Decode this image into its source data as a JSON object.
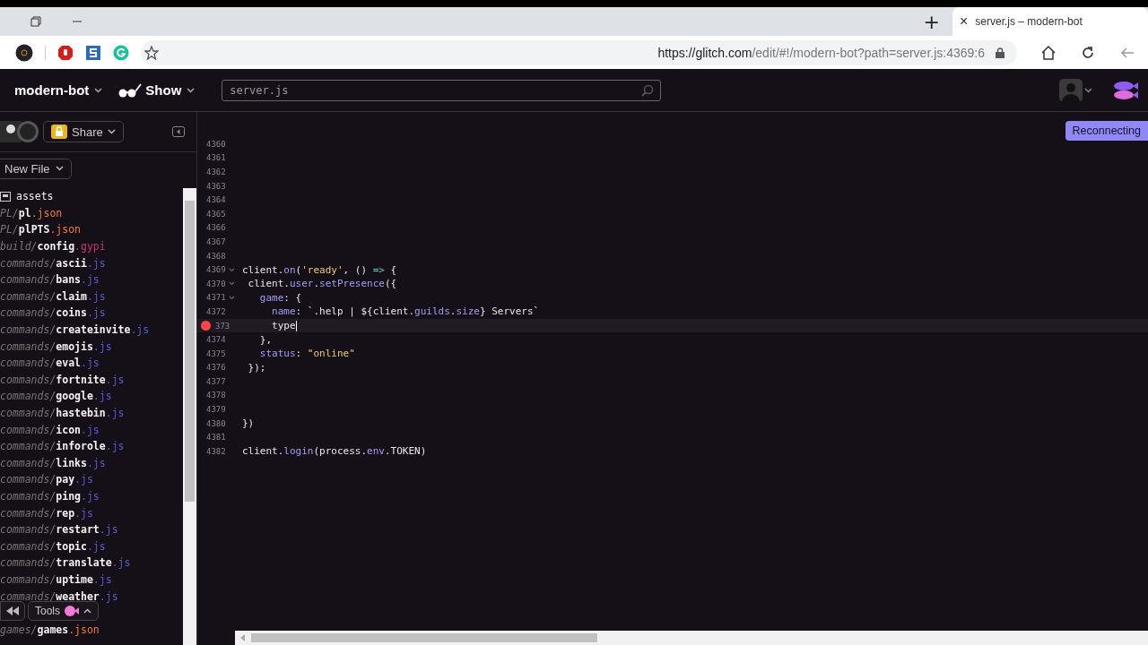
{
  "browser": {
    "tab_title": "server.js – modern-bot",
    "tab_close": "×",
    "new_tab": "+",
    "url_host": "https://glitch.com",
    "url_path": "/edit/#!/modern-bot?path=server.js:4369:6"
  },
  "header": {
    "project": "modern-bot",
    "show": "Show",
    "search": {
      "value": "server.js"
    }
  },
  "sidebar": {
    "share": "Share",
    "new_file": "New File",
    "assets": "assets",
    "files": [
      {
        "dir": "PL/",
        "name": "pl",
        "ext": ".json",
        "kind": "json"
      },
      {
        "dir": "PL/",
        "name": "plPTS",
        "ext": ".json",
        "kind": "json"
      },
      {
        "dir": "build/",
        "name": "config",
        "ext": ".gypi",
        "kind": "gypi"
      },
      {
        "dir": "commands/",
        "name": "ascii",
        "ext": ".js",
        "kind": "js"
      },
      {
        "dir": "commands/",
        "name": "bans",
        "ext": ".js",
        "kind": "js"
      },
      {
        "dir": "commands/",
        "name": "claim",
        "ext": ".js",
        "kind": "js"
      },
      {
        "dir": "commands/",
        "name": "coins",
        "ext": ".js",
        "kind": "js"
      },
      {
        "dir": "commands/",
        "name": "createinvite",
        "ext": ".js",
        "kind": "js"
      },
      {
        "dir": "commands/",
        "name": "emojis",
        "ext": ".js",
        "kind": "js"
      },
      {
        "dir": "commands/",
        "name": "eval",
        "ext": ".js",
        "kind": "js"
      },
      {
        "dir": "commands/",
        "name": "fortnite",
        "ext": ".js",
        "kind": "js"
      },
      {
        "dir": "commands/",
        "name": "google",
        "ext": ".js",
        "kind": "js"
      },
      {
        "dir": "commands/",
        "name": "hastebin",
        "ext": ".js",
        "kind": "js"
      },
      {
        "dir": "commands/",
        "name": "icon",
        "ext": ".js",
        "kind": "js"
      },
      {
        "dir": "commands/",
        "name": "inforole",
        "ext": ".js",
        "kind": "js"
      },
      {
        "dir": "commands/",
        "name": "links",
        "ext": ".js",
        "kind": "js"
      },
      {
        "dir": "commands/",
        "name": "pay",
        "ext": ".js",
        "kind": "js"
      },
      {
        "dir": "commands/",
        "name": "ping",
        "ext": ".js",
        "kind": "js"
      },
      {
        "dir": "commands/",
        "name": "rep",
        "ext": ".js",
        "kind": "js"
      },
      {
        "dir": "commands/",
        "name": "restart",
        "ext": ".js",
        "kind": "js"
      },
      {
        "dir": "commands/",
        "name": "topic",
        "ext": ".js",
        "kind": "js"
      },
      {
        "dir": "commands/",
        "name": "translate",
        "ext": ".js",
        "kind": "js"
      },
      {
        "dir": "commands/",
        "name": "uptime",
        "ext": ".js",
        "kind": "js"
      },
      {
        "dir": "commands/",
        "name": "weather",
        "ext": ".js",
        "kind": "js"
      }
    ],
    "tools": "Tools",
    "below_tools": {
      "dir": "games/",
      "name": "games",
      "ext": ".json",
      "kind": "json"
    }
  },
  "status_badge": "Reconnecting",
  "editor": {
    "lines": [
      {
        "number": "4360"
      },
      {
        "number": "4361"
      },
      {
        "number": "4362"
      },
      {
        "number": "4363"
      },
      {
        "number": "4364"
      },
      {
        "number": "4365"
      },
      {
        "number": "4366"
      },
      {
        "number": "4367"
      },
      {
        "number": "4368"
      },
      {
        "number": "4369",
        "fold": true,
        "tokens": [
          {
            "t": "client.",
            "kind": "plain"
          },
          {
            "t": "on",
            "kind": "prop"
          },
          {
            "t": "(",
            "kind": "plain"
          },
          {
            "t": "'ready'",
            "kind": "string"
          },
          {
            "t": ", () ",
            "kind": "plain"
          },
          {
            "t": "=>",
            "kind": "arrow"
          },
          {
            "t": " {",
            "kind": "plain"
          }
        ]
      },
      {
        "number": "4370",
        "fold": true,
        "tokens": [
          {
            "t": " client.",
            "kind": "plain"
          },
          {
            "t": "user",
            "kind": "prop"
          },
          {
            "t": ".",
            "kind": "plain"
          },
          {
            "t": "setPresence",
            "kind": "prop"
          },
          {
            "t": "({",
            "kind": "plain"
          }
        ]
      },
      {
        "number": "4371",
        "fold": true,
        "tokens": [
          {
            "t": "   game",
            "kind": "prop"
          },
          {
            "t": ": {",
            "kind": "plain"
          }
        ]
      },
      {
        "number": "4372",
        "tokens": [
          {
            "t": "     name",
            "kind": "prop"
          },
          {
            "t": ": `.help | ${client.",
            "kind": "plain"
          },
          {
            "t": "guilds",
            "kind": "prop"
          },
          {
            "t": ".",
            "kind": "plain"
          },
          {
            "t": "size",
            "kind": "prop"
          },
          {
            "t": "} Servers`",
            "kind": "plain"
          }
        ]
      },
      {
        "number": "373",
        "error": true,
        "current": true,
        "tokens": [
          {
            "t": "     type",
            "kind": "plain"
          }
        ]
      },
      {
        "number": "4374",
        "tokens": [
          {
            "t": "   },",
            "kind": "plain"
          }
        ]
      },
      {
        "number": "4375",
        "tokens": [
          {
            "t": "   status",
            "kind": "prop"
          },
          {
            "t": ": ",
            "kind": "plain"
          },
          {
            "t": "\"online\"",
            "kind": "string"
          }
        ]
      },
      {
        "number": "4376",
        "tokens": [
          {
            "t": " });",
            "kind": "plain"
          }
        ]
      },
      {
        "number": "4377"
      },
      {
        "number": "4378"
      },
      {
        "number": "4379"
      },
      {
        "number": "4380",
        "tokens": [
          {
            "t": "})",
            "kind": "plain"
          }
        ]
      },
      {
        "number": "4381"
      },
      {
        "number": "4382",
        "tokens": [
          {
            "t": "client.",
            "kind": "plain"
          },
          {
            "t": "login",
            "kind": "prop"
          },
          {
            "t": "(process.",
            "kind": "plain"
          },
          {
            "t": "env",
            "kind": "prop"
          },
          {
            "t": ".TOKEN)",
            "kind": "plain"
          }
        ]
      }
    ]
  }
}
